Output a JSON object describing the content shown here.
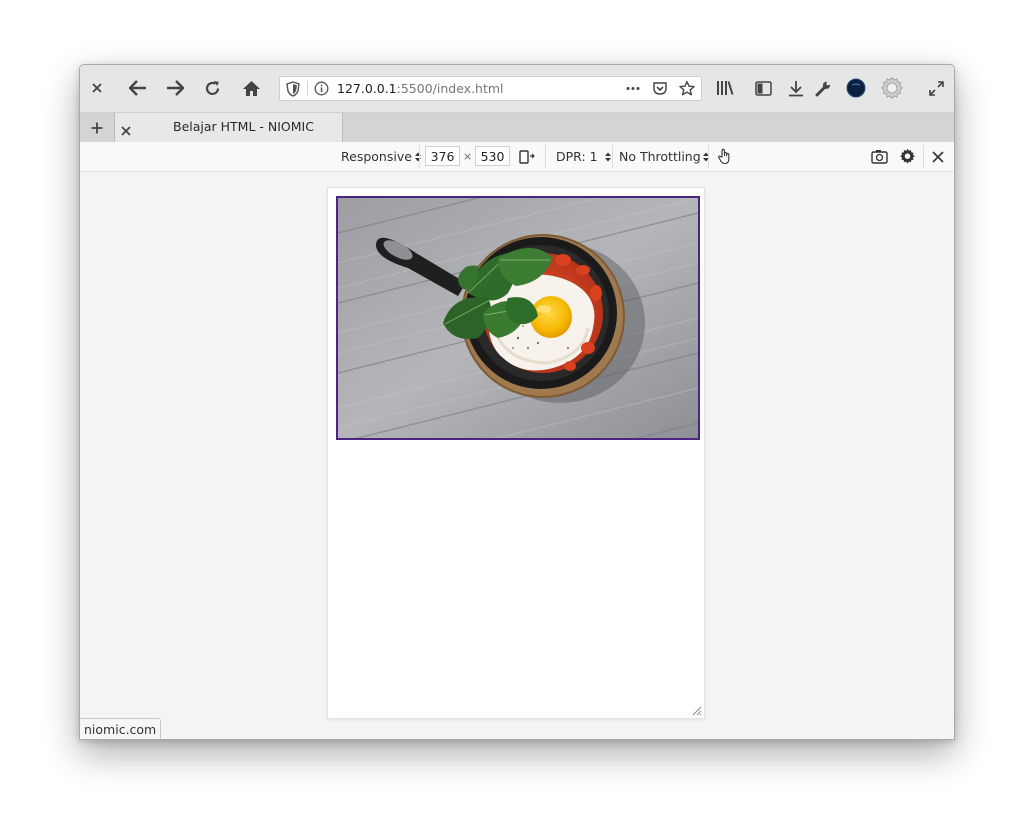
{
  "toolbar": {
    "close_icon": "close-icon",
    "back_icon": "back-arrow-icon",
    "forward_icon": "forward-arrow-icon",
    "reload_icon": "reload-icon",
    "home_icon": "home-icon",
    "url_host": "127.0.0.1",
    "url_rest": ":5500/index.html",
    "menu_icons": [
      "library-icon",
      "sidebar-icon",
      "download-icon",
      "wrench-icon",
      "account-avatar-icon",
      "settings-gear-icon",
      "fullscreen-icon"
    ]
  },
  "tabs": {
    "new_tab_label": "+",
    "active_title": "Belajar HTML - NIOMIC"
  },
  "responsive_toolbar": {
    "device_label": "Responsive",
    "width_value": "376",
    "times": "×",
    "height_value": "530",
    "dpr_label": "DPR: 1",
    "throttling_label": "No Throttling"
  },
  "page": {
    "image_alt": "shakshuka in cast iron pan"
  },
  "status": {
    "text": "niomic.com"
  },
  "colors": {
    "image_border": "#4b2580",
    "toolbar_bg": "#e6e6e6",
    "viewport_bg": "#f4f4f4"
  }
}
